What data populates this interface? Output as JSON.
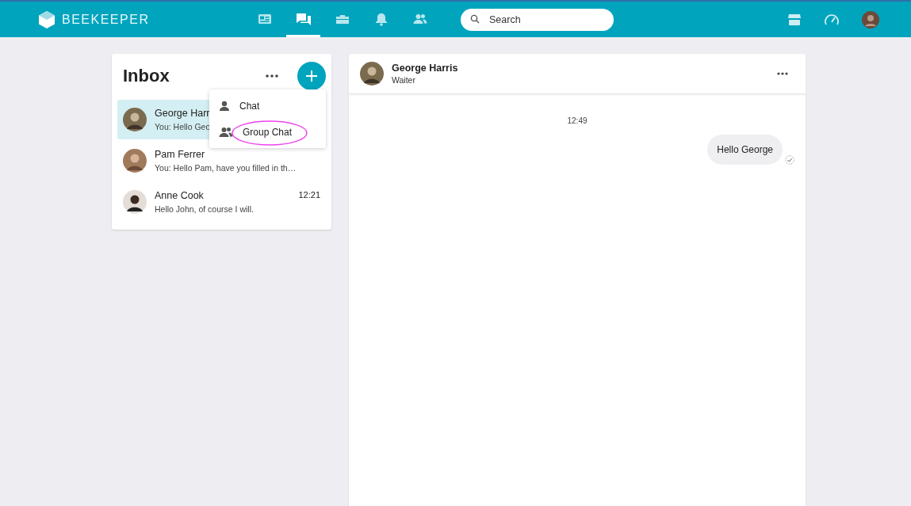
{
  "topbar": {
    "brand": "BEEKEEPER",
    "nav": [
      {
        "kind": "news",
        "selected": false
      },
      {
        "kind": "chat",
        "selected": true
      },
      {
        "kind": "toolbox",
        "selected": false
      },
      {
        "kind": "bell",
        "selected": false
      },
      {
        "kind": "people",
        "selected": false
      }
    ],
    "search": {
      "placeholder": "Search"
    }
  },
  "inbox": {
    "title": "Inbox",
    "conversations": [
      {
        "name": "George Harr",
        "preview": "You: Hello Geo",
        "selected": true
      },
      {
        "name": "Pam Ferrer",
        "preview": "You: Hello Pam, have you filled in th…",
        "selected": false
      },
      {
        "name": "Anne Cook",
        "time": "12:21",
        "preview": "Hello John, of course I will.",
        "selected": false
      }
    ],
    "new_menu": [
      {
        "kind": "person",
        "label": "Chat",
        "highlighted": false
      },
      {
        "kind": "group",
        "label": "Group Chat",
        "highlighted": true
      }
    ]
  },
  "chat": {
    "name": "George Harris",
    "role": "Waiter",
    "day_time": "12:49",
    "messages": [
      {
        "text": "Hello George",
        "read": true
      }
    ]
  }
}
